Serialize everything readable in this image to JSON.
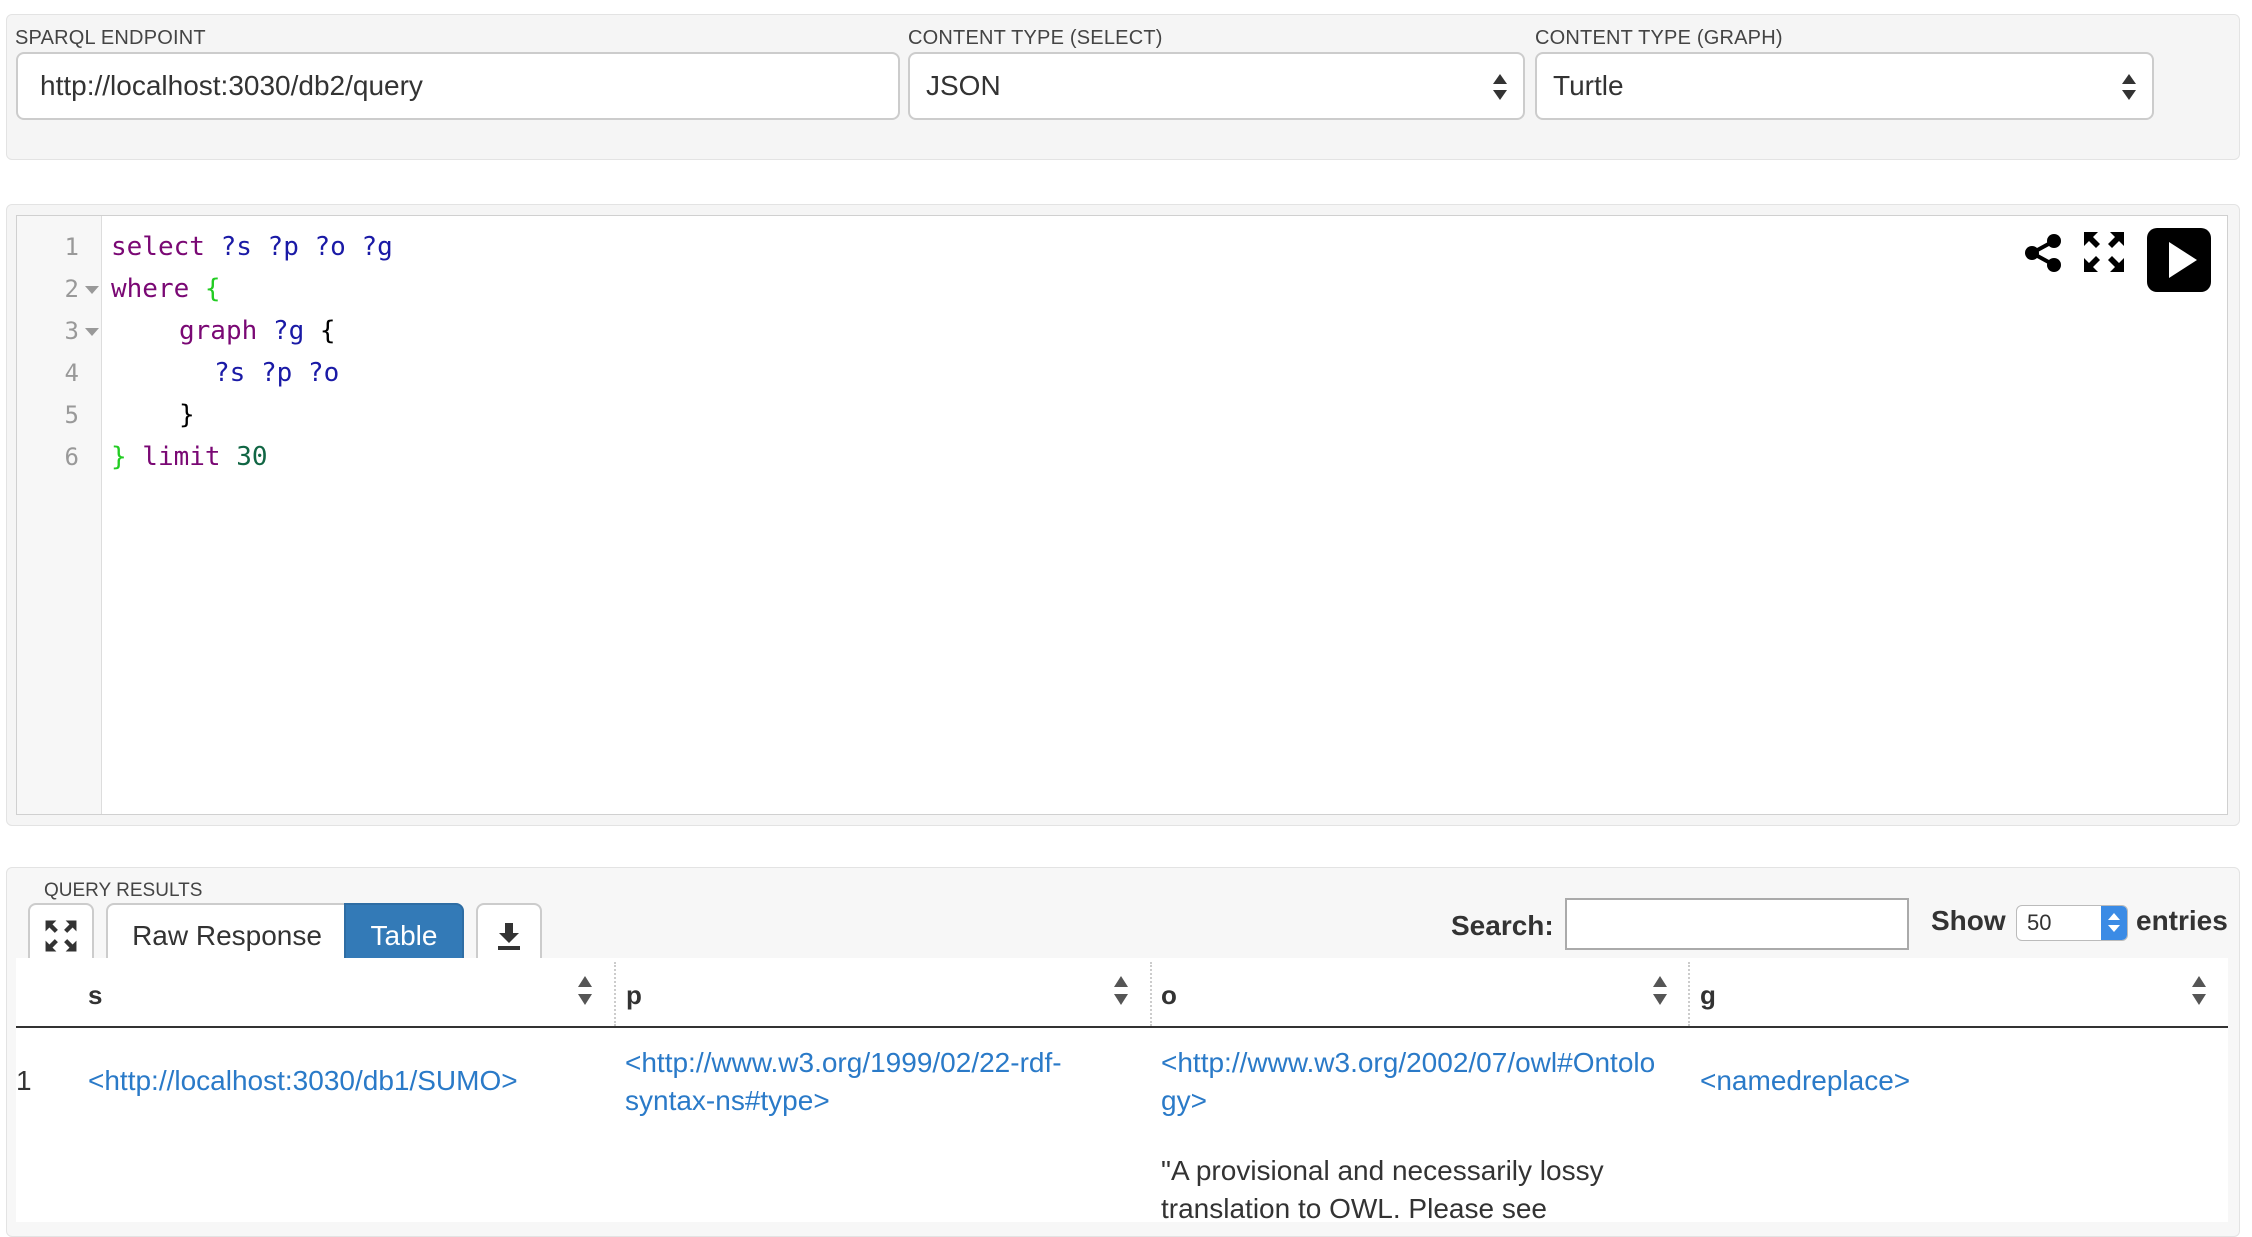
{
  "config": {
    "endpoint_label": "SPARQL ENDPOINT",
    "endpoint_value": "http://localhost:3030/db2/query",
    "select_type_label": "CONTENT TYPE (SELECT)",
    "select_type_value": "JSON",
    "graph_type_label": "CONTENT TYPE (GRAPH)",
    "graph_type_value": "Turtle"
  },
  "editor": {
    "line_numbers": [
      "1",
      "2",
      "3",
      "4",
      "5",
      "6"
    ],
    "tokens": {
      "l1_kw": "select",
      "l1_vars": " ?s ?p ?o ?g",
      "l2_kw": "where",
      "l2_brace": " {",
      "l3_kw": "graph",
      "l3_var": " ?g",
      "l3_plain": " {",
      "l4_vars": "?s ?p ?o",
      "l5_plain": "}",
      "l6_brace": "}",
      "l6_kw": " limit",
      "l6_num": " 30"
    },
    "icons": [
      "share-icon",
      "fullscreen-icon",
      "play-icon"
    ]
  },
  "results": {
    "label": "QUERY RESULTS",
    "raw_label": "Raw Response",
    "table_label": "Table",
    "search_label": "Search:",
    "search_value": "",
    "show_label": "Show",
    "show_value": "50",
    "entries_label": "entries",
    "columns": [
      "s",
      "p",
      "o",
      "g"
    ],
    "row1": {
      "num": "1",
      "s": "<http://localhost:3030/db1/SUMO>",
      "p_line1": "<http://www.w3.org/1999/02/22-rdf-",
      "p_line2": "syntax-ns#type>",
      "o_line1": "<http://www.w3.org/2002/07/owl#Ontolo",
      "o_line2": "gy>",
      "g": "<namedreplace>"
    },
    "row2": {
      "o_line1": "\"A provisional and necessarily lossy",
      "o_line2": "translation to OWL. Please see"
    }
  },
  "colors": {
    "accent": "#337ab7",
    "link": "#2a7ac8"
  }
}
